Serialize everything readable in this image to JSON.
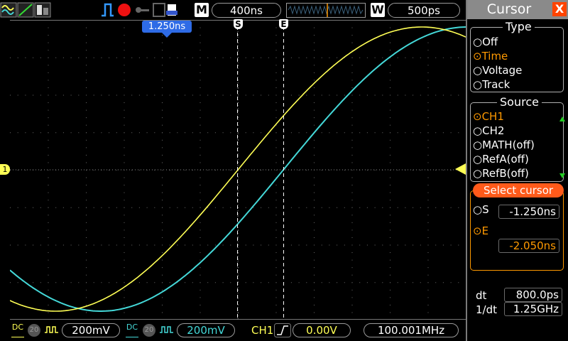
{
  "topbar": {
    "run_mode_label": "M",
    "timebase": "400ns",
    "window_label": "W",
    "window_timebase": "500ps"
  },
  "screen": {
    "marker_label": "1.250ns",
    "cursor_s_label": "S",
    "cursor_e_label": "E",
    "ch1_marker": "1"
  },
  "bottombar": {
    "ch1_coupling": "DC",
    "ch1_probe": "20",
    "ch1_volts": "200mV",
    "ch2_coupling": "DC",
    "ch2_probe": "20",
    "ch2_volts": "200mV",
    "trigger_source": "CH1",
    "trigger_level": "0.00V",
    "frequency": "100.001MHz"
  },
  "panel": {
    "title": "Cursor",
    "close_label": "X",
    "type": {
      "label": "Type",
      "options": [
        "Off",
        "Time",
        "Voltage",
        "Track"
      ],
      "selected": "Time"
    },
    "source": {
      "label": "Source",
      "options": [
        "CH1",
        "CH2",
        "MATH(off)",
        "RefA(off)",
        "RefB(off)"
      ],
      "selected": "CH1"
    },
    "select_cursor": {
      "label": "Select cursor",
      "s_label": "S",
      "s_value": "-1.250ns",
      "e_label": "E",
      "e_value": "-2.050ns"
    },
    "readout": {
      "dt_label": "dt",
      "dt_value": "800.0ps",
      "inv_dt_label": "1/dt",
      "inv_dt_value": "1.25GHz"
    }
  },
  "colors": {
    "ch1": "#ffff55",
    "ch2": "#44d8d8",
    "accent": "#ff9900",
    "close": "#ff4400",
    "marker": "#2e6be6"
  }
}
